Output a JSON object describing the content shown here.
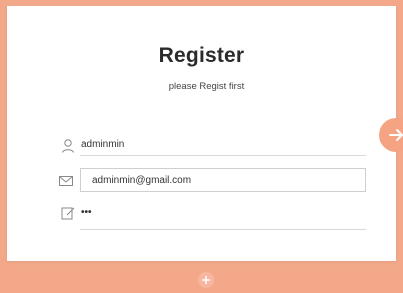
{
  "header": {
    "title": "Register",
    "subtitle": "please Regist first"
  },
  "form": {
    "username_value": "adminmin",
    "email_value": "adminmin@gmail.com",
    "password_value": "•••"
  },
  "icons": {
    "username": "user-icon",
    "email": "envelope-icon",
    "password": "edit-icon",
    "submit": "arrow-right-icon",
    "toggle": "plus-icon"
  },
  "colors": {
    "background": "#f3a88a",
    "card": "#ffffff",
    "accent": "#f5a383",
    "text": "#2b2b2b"
  }
}
